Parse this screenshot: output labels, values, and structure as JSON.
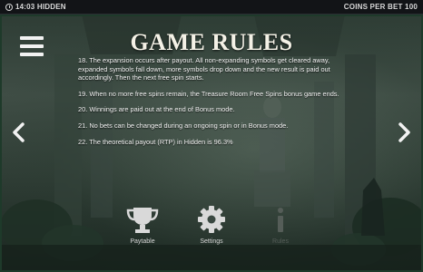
{
  "status_bar": {
    "left_text": "14:03 HIDDEN",
    "right_text": "COINS PER BET 100"
  },
  "title": "GAME RULES",
  "rules": [
    "18. The expansion occurs after payout. All non-expanding symbols get cleared away, expanded symbols fall down, more symbols drop down and the new result is paid out accordingly. Then the next free spin starts.",
    "19. When no more free spins remain, the Treasure Room Free Spins bonus game ends.",
    "20. Winnings are paid out at the end of Bonus mode.",
    "21. No bets can be changed during an ongoing spin or in Bonus mode.",
    "22. The theoretical payout (RTP) in Hidden is 96.3%"
  ],
  "bottom_nav": {
    "paytable_label": "Paytable",
    "settings_label": "Settings",
    "rules_label": "Rules"
  },
  "colors": {
    "status_bar_bg": "#121417",
    "text": "#f4f4f4",
    "disabled": "#555d58",
    "frame": "#1e3a2a"
  },
  "icons": {
    "clock": "clock-icon",
    "menu": "hamburger-menu-icon",
    "prev": "chevron-left-icon",
    "next": "chevron-right-icon",
    "paytable": "trophy-icon",
    "settings": "gear-icon",
    "rules": "info-icon"
  }
}
